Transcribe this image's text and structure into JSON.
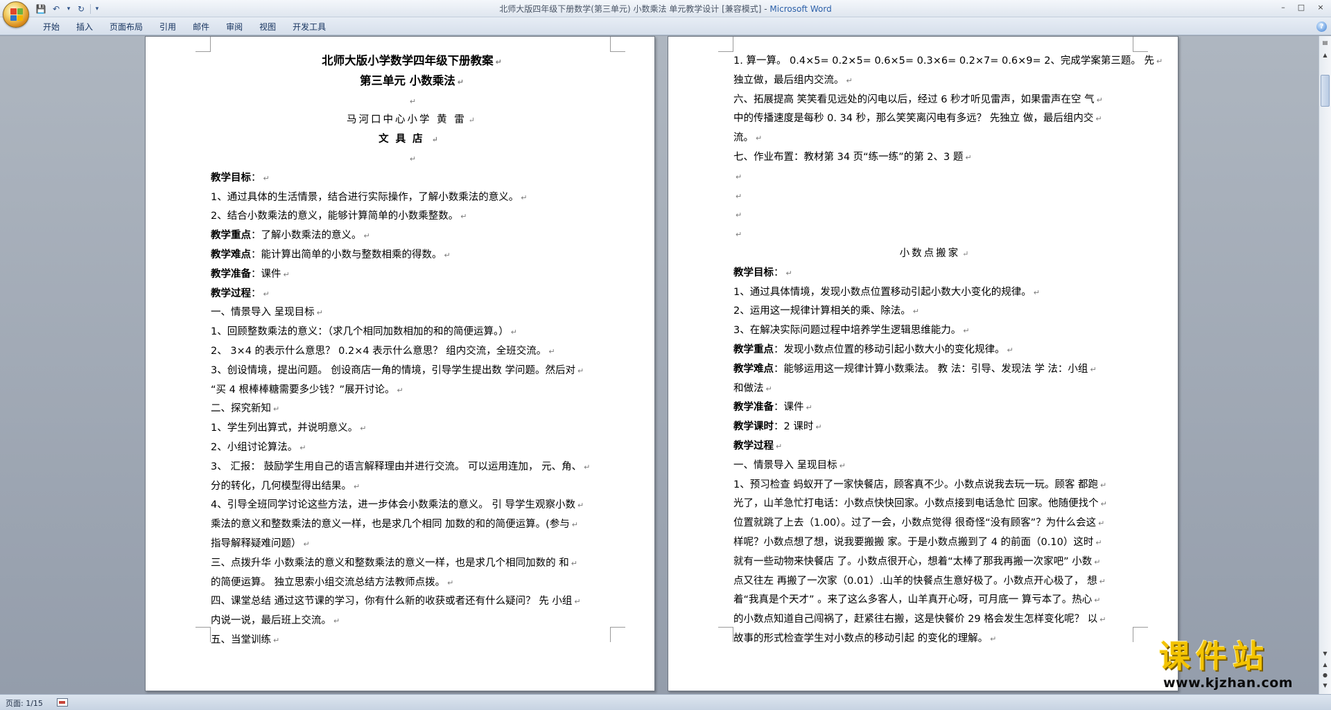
{
  "window": {
    "title": "北师大版四年级下册数学(第三单元) 小数乘法    单元教学设计 [兼容模式] - ",
    "app_name": "Microsoft Word",
    "minimize": "–",
    "maximize": "□",
    "close": "×"
  },
  "quick_access": {
    "save": "💾",
    "undo": "↶",
    "undo_dropdown": "▾",
    "redo": "↻",
    "customize": "▾"
  },
  "ribbon": {
    "tabs": [
      "开始",
      "插入",
      "页面布局",
      "引用",
      "邮件",
      "审阅",
      "视图",
      "开发工具"
    ],
    "help": "?"
  },
  "page_left": {
    "lines": [
      {
        "text": "北师大版小学数学四年级下册教案",
        "style": "title center"
      },
      {
        "text": "第三单元  小数乘法",
        "style": "title center"
      },
      {
        "text": "",
        "style": "center"
      },
      {
        "text": "马河口中心小学   黄 雷",
        "style": "serif center"
      },
      {
        "text": "文具店",
        "style": "bold-serif center"
      },
      {
        "text": "",
        "style": "center"
      },
      {
        "label": "教学目标",
        "text": "：",
        "style": ""
      },
      {
        "text": "1、通过具体的生活情景，结合进行实际操作，了解小数乘法的意义。",
        "style": ""
      },
      {
        "text": "2、结合小数乘法的意义，能够计算简单的小数乘整数。",
        "style": ""
      },
      {
        "label": "教学重点",
        "text": "：了解小数乘法的意义。",
        "style": ""
      },
      {
        "label": "教学难点",
        "text": "：能计算出简单的小数与整数相乘的得数。",
        "style": ""
      },
      {
        "label": "教学准备",
        "text": "：课件",
        "style": ""
      },
      {
        "label": "教学过程",
        "text": "：",
        "style": ""
      },
      {
        "text": "一、情景导入 呈现目标",
        "style": ""
      },
      {
        "text": "1、回顾整数乘法的意义：（求几个相同加数相加的和的简便运算。）",
        "style": ""
      },
      {
        "text": "2、 3×4 的表示什么意思？  0.2×4 表示什么意思？ 组内交流，全班交流。",
        "style": ""
      },
      {
        "text": "3、创设情境，提出问题。 创设商店一角的情境，引导学生提出数 学问题。然后对",
        "style": ""
      },
      {
        "text": "“买 4 根棒棒糖需要多少钱？”展开讨论。",
        "style": ""
      },
      {
        "text": "二、探究新知",
        "style": ""
      },
      {
        "text": "1、学生列出算式，并说明意义。",
        "style": ""
      },
      {
        "text": "2、小组讨论算法。",
        "style": ""
      },
      {
        "text": "3、 汇报： 鼓励学生用自己的语言解释理由并进行交流。 可以运用连加， 元、角、",
        "style": ""
      },
      {
        "text": "分的转化，几何模型得出结果。",
        "style": ""
      },
      {
        "text": "4、引导全班同学讨论这些方法，进一步体会小数乘法的意义。 引 导学生观察小数",
        "style": ""
      },
      {
        "text": "乘法的意义和整数乘法的意义一样，也是求几个相同 加数的和的简便运算。(参与",
        "style": ""
      },
      {
        "text": "指导解释疑难问题）",
        "style": ""
      },
      {
        "text": "三、点拨升华 小数乘法的意义和整数乘法的意义一样，也是求几个相同加数的 和",
        "style": ""
      },
      {
        "text": "的简便运算。 独立思索小组交流总结方法教师点拨。",
        "style": ""
      },
      {
        "text": "四、课堂总结 通过这节课的学习，你有什么新的收获或者还有什么疑问？ 先 小组",
        "style": ""
      },
      {
        "text": "内说一说，最后班上交流。",
        "style": ""
      },
      {
        "text": "五、当堂训练",
        "style": ""
      }
    ]
  },
  "page_right": {
    "lines": [
      {
        "text": "1. 算一算。  0.4×5= 0.2×5= 0.6×5= 0.3×6= 0.2×7= 0.6×9= 2、完成学案第三题。 先",
        "style": ""
      },
      {
        "text": "独立做，最后组内交流。",
        "style": ""
      },
      {
        "text": "六、拓展提高 笑笑看见远处的闪电以后，经过 6 秒才听见雷声，如果雷声在空 气",
        "style": ""
      },
      {
        "text": "中的传播速度是每秒 0. 34 秒，那么笑笑离闪电有多远？ 先独立 做，最后组内交",
        "style": ""
      },
      {
        "text": "流。",
        "style": ""
      },
      {
        "text": "七、作业布置：教材第 34 页“练一练”的第 2、3 题",
        "style": ""
      },
      {
        "text": "",
        "style": ""
      },
      {
        "text": "",
        "style": ""
      },
      {
        "text": "",
        "style": ""
      },
      {
        "text": "",
        "style": ""
      },
      {
        "text": "小数点搬家",
        "style": "serif center"
      },
      {
        "label": "教学目标",
        "text": "：",
        "style": ""
      },
      {
        "text": "1、通过具体情境，发现小数点位置移动引起小数大小变化的规律。",
        "style": ""
      },
      {
        "text": "2、运用这一规律计算相关的乘、除法。",
        "style": ""
      },
      {
        "text": "3、在解决实际问题过程中培养学生逻辑思维能力。",
        "style": ""
      },
      {
        "label": "教学重点",
        "text": "：发现小数点位置的移动引起小数大小的变化规律。",
        "style": ""
      },
      {
        "label": "教学难点",
        "text": "：能够运用这一规律计算小数乘法。 教 法：引导、发现法 学 法：小组",
        "style": ""
      },
      {
        "text": "和做法",
        "style": ""
      },
      {
        "label": "教学准备",
        "text": "：课件",
        "style": ""
      },
      {
        "label": "教学课时",
        "text": "：2 课时",
        "style": ""
      },
      {
        "label": "教学过程",
        "text": "",
        "style": ""
      },
      {
        "text": "一、情景导入 呈现目标",
        "style": ""
      },
      {
        "text": "1、预习检查 蚂蚁开了一家快餐店，顾客真不少。小数点说我去玩一玩。顾客 都跑",
        "style": ""
      },
      {
        "text": "光了，山羊急忙打电话：小数点快快回家。小数点接到电话急忙 回家。他随便找个",
        "style": ""
      },
      {
        "text": "位置就跳了上去（1.00）。过了一会，小数点觉得 很奇怪“没有顾客”？为什么会这",
        "style": ""
      },
      {
        "text": "样呢？小数点想了想，说我要搬搬 家。于是小数点搬到了 4 的前面（0.10）这时",
        "style": ""
      },
      {
        "text": "就有一些动物来快餐店 了。小数点很开心，想着“太棒了那我再搬一次家吧” 小数",
        "style": ""
      },
      {
        "text": "点又往左 再搬了一次家（0.01）.山羊的快餐点生意好极了。小数点开心极了， 想",
        "style": ""
      },
      {
        "text": "着“我真是个天才”  。来了这么多客人，山羊真开心呀，可月底一 算亏本了。热心",
        "style": ""
      },
      {
        "text": "的小数点知道自己闯祸了，赶紧往右搬，这是快餐价 29 格会发生怎样变化呢？ 以",
        "style": ""
      },
      {
        "text": "故事的形式检查学生对小数点的移动引起 的变化的理解。",
        "style": ""
      }
    ]
  },
  "paragraph_mark": "↵",
  "status": {
    "page_indicator": "页面: 1/15"
  },
  "watermark": {
    "main": "课件站",
    "url": "www.kjzhan.com",
    "color": "#f3c300"
  }
}
